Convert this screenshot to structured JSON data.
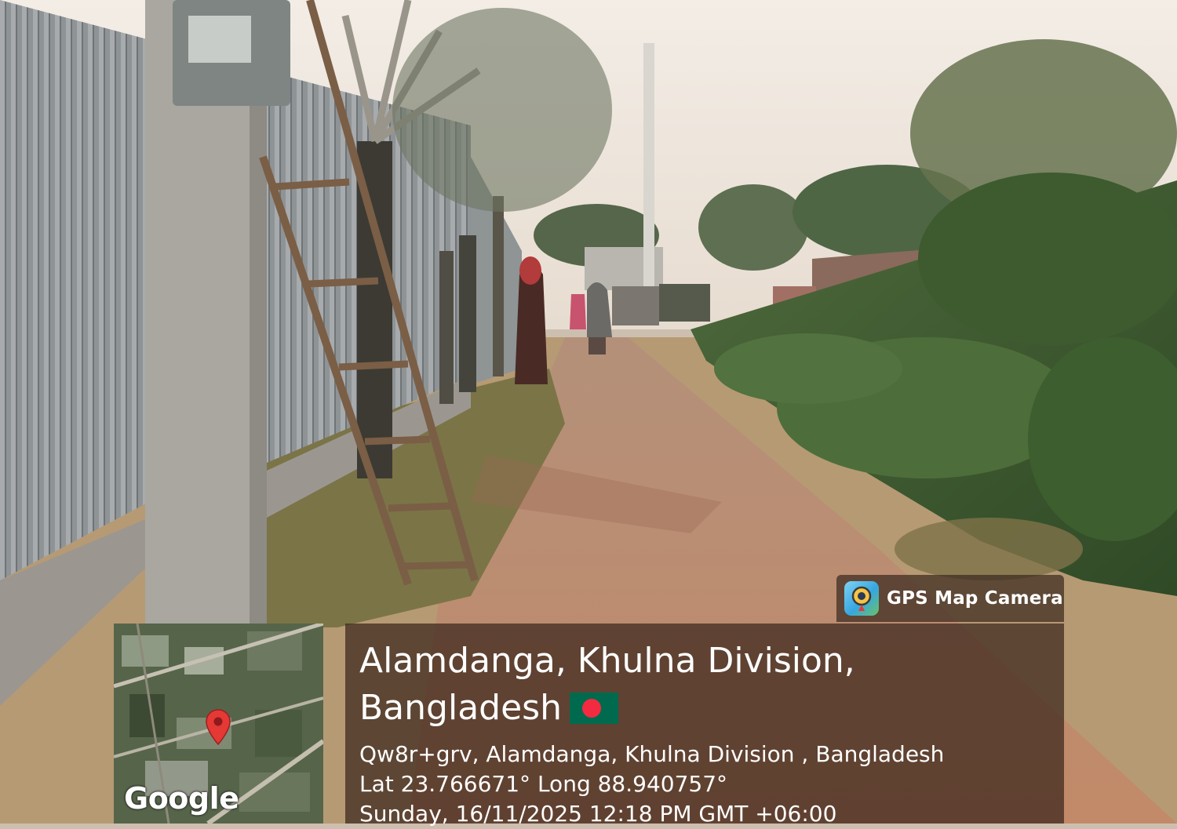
{
  "photo": {
    "subject": "dirt-lane-scene"
  },
  "gps_overlay": {
    "app_name": "GPS Map Camera",
    "app_icon": "gps-map-camera-icon",
    "place_line1": "Alamdanga, Khulna Division,",
    "place_line2": "Bangladesh",
    "flag_icon": "bangladesh-flag-icon",
    "address": "Qw8r+grv, Alamdanga, Khulna Division , Bangladesh",
    "coordinates": "Lat 23.766671° Long 88.940757°",
    "datetime": "Sunday, 16/11/2025 12:18 PM GMT +06:00",
    "map_attribution": "Google",
    "map_pin_icon": "map-pin-icon"
  },
  "colors": {
    "panel_bg": "#3a261c",
    "flag_green": "#006a4e",
    "flag_red": "#f42a41",
    "pin_red": "#e53935"
  }
}
